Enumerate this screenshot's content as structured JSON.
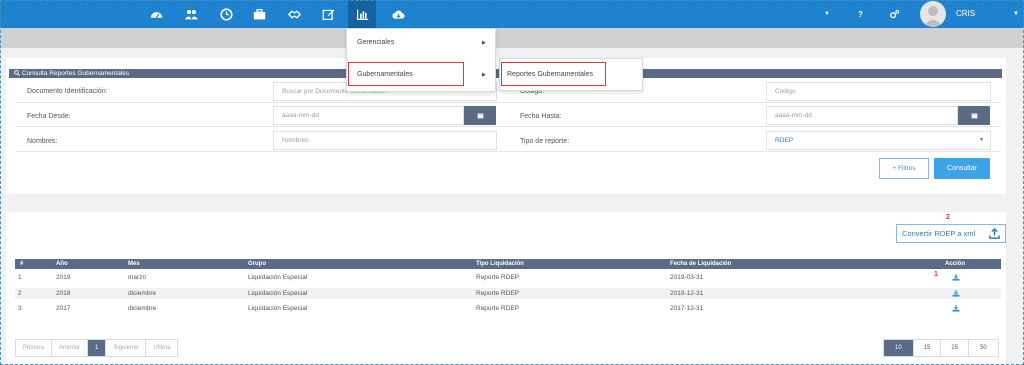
{
  "topbar": {
    "icons": [
      "dashboard-icon",
      "users-icon",
      "clock-icon",
      "briefcase-icon",
      "handshake-icon",
      "edit-icon",
      "bar-chart-icon",
      "cloud-download-icon"
    ],
    "right_icons": [
      "caret-down-icon",
      "help-icon",
      "cogs-icon",
      "caret-down-icon"
    ],
    "help_label": "?",
    "user_name": "CRIS",
    "bg_color": "#1f82cf"
  },
  "menu": {
    "items": [
      "Gerenciales",
      "Gubernamentales"
    ],
    "submenu_item": "Reportes Gubernamentales"
  },
  "search": {
    "title": "Consulta Reportes Gubernamentales",
    "fields": {
      "doc_label": "Documento Identificación:",
      "doc_placeholder": "Buscar por Documento Identificación",
      "codigo_label": "Codigo:",
      "codigo_placeholder": "Codigo",
      "fecha_desde_label": "Fecha Desde:",
      "fecha_desde_placeholder": "aaaa-mm-dd",
      "fecha_hasta_label": "Fecha Hasta:",
      "fecha_hasta_placeholder": "aaaa-mm-dd",
      "nombres_label": "Nombres:",
      "nombres_placeholder": "Nombres",
      "tipo_label": "Tipo de reporte:",
      "tipo_value": "RDEP"
    },
    "filtros_label": "+ Filtros",
    "consultar_label": "Consultar"
  },
  "results": {
    "convert_label": "Convertir RDEP a xml",
    "annotation_2": "2",
    "annotation_1": "1",
    "columns": [
      "#",
      "Año",
      "Mes",
      "Grupo",
      "Tipo Liquidación",
      "Fecha de Liquidación",
      "Acción"
    ],
    "rows": [
      [
        "1",
        "2019",
        "marzo",
        "Liquidación Especial",
        "Reporte RDEP",
        "2019-03-31"
      ],
      [
        "2",
        "2018",
        "diciembre",
        "Liquidación Especial",
        "Reporte RDEP",
        "2018-12-31"
      ],
      [
        "3",
        "2017",
        "diciembre",
        "Liquidación Especial",
        "Reporte RDEP",
        "2017-12-31"
      ]
    ],
    "pagination": [
      "Primera",
      "Anterior",
      "1",
      "Siguiente",
      "Ultima"
    ],
    "page_sizes": [
      "10",
      "15",
      "25",
      "50"
    ]
  },
  "colors": {
    "accent": "#1f82cf",
    "table_header": "#5a6b86",
    "highlight": "#d9363e"
  }
}
